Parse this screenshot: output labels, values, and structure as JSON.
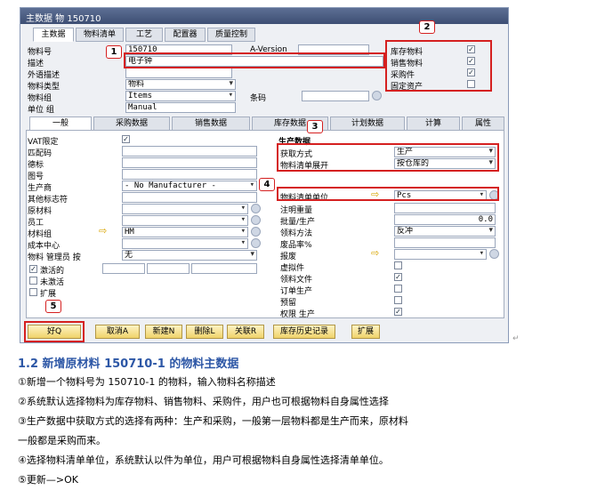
{
  "window": {
    "title": "主数据 物 150710",
    "tabs": [
      "主数据",
      "物料清单",
      "工艺",
      "配置器",
      "质量控制"
    ],
    "fields": {
      "item_no_label": "物料号",
      "item_no_value": "150710",
      "desc_label": "描述",
      "desc_value": "电子钟",
      "foreign_desc_label": "外语描述",
      "item_type_label": "物料类型",
      "item_type_value": "物料",
      "item_group_label": "物料组",
      "item_group_value": "Items",
      "uom_group_label": "单位 组",
      "uom_group_value": "Manual",
      "aversion_label": "A-Version",
      "barcode_label": "条码"
    },
    "properties": {
      "items": [
        {
          "label": "库存物料",
          "checked": true
        },
        {
          "label": "销售物料",
          "checked": true
        },
        {
          "label": "采购件",
          "checked": true
        },
        {
          "label": "固定资产",
          "checked": false
        }
      ]
    },
    "subtabs": [
      "一般",
      "采购数据",
      "销售数据",
      "库存数据",
      "计划数据",
      "计算",
      "属性"
    ],
    "general": {
      "vat_label": "VAT限定",
      "vat_checked": true,
      "rows": [
        "匹配码",
        "德标",
        "图号",
        "生产商",
        "其他标志符",
        "原材料",
        "员工",
        "材料组",
        "成本中心",
        "物料 管理员 按"
      ],
      "manufacturer_value": "- No Manufacturer -",
      "material_group_value": "HM",
      "manager_value": "无",
      "status": [
        {
          "label": "激活的",
          "checked": true
        },
        {
          "label": "未激活",
          "checked": false
        },
        {
          "label": "扩展",
          "checked": false
        }
      ]
    },
    "production": {
      "header": "生产数据",
      "procurement_label": "获取方式",
      "procurement_value": "生产",
      "bom_expand_label": "物料清单展开",
      "bom_expand_value": "按仓库的",
      "bom_unit_label": "物料清单单位",
      "bom_unit_value": "Pcs",
      "other_rows": [
        {
          "label": "注明重量",
          "value": ""
        },
        {
          "label": "批量/生产",
          "value": "0.0"
        },
        {
          "label": "领料方法",
          "value": "反冲"
        },
        {
          "label": "废品率%",
          "value": ""
        },
        {
          "label": "报废",
          "value": ""
        }
      ],
      "checks": [
        {
          "label": "虚拟件",
          "checked": false
        },
        {
          "label": "领料文件",
          "checked": true
        },
        {
          "label": "订单生产",
          "checked": false
        },
        {
          "label": "预留",
          "checked": false
        },
        {
          "label": "权限 生产",
          "checked": true
        }
      ]
    },
    "buttons": [
      "好Q",
      "取消A",
      "新建N",
      "删除L",
      "关联R",
      "库存历史记录",
      "扩展"
    ]
  },
  "callouts": [
    "1",
    "2",
    "3",
    "4",
    "5"
  ],
  "doc": {
    "heading": "1.2 新增原材料 150710-1 的物料主数据",
    "lines": [
      "①新增一个物料号为 150710-1 的物料，输入物料名称描述",
      "②系统默认选择物料为库存物料、销售物料、采购件，用户也可根据物料自身属性选择",
      "③生产数据中获取方式的选择有两种：生产和采购，一般第一层物料都是生产而来，原材料",
      "一般都是采购而来。",
      "④选择物料清单单位，系统默认以件为单位，用户可根据物料自身属性选择清单单位。",
      "⑤更新—>OK"
    ]
  },
  "colors": {
    "callout_red": "#d52020",
    "heading_blue": "#2d57a6",
    "button_yellow": "#f0d36a"
  }
}
